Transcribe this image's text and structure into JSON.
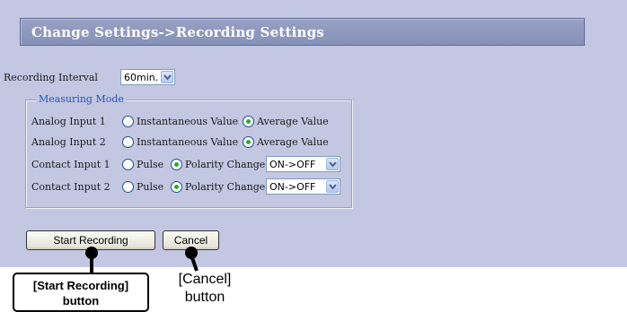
{
  "header": {
    "title": "Change Settings->Recording Settings"
  },
  "recording_interval": {
    "label": "Recording Interval",
    "value": "60min."
  },
  "measuring_mode": {
    "legend": "Measuring Mode",
    "rows": [
      {
        "label": "Analog Input 1",
        "option_a": "Instantaneous Value",
        "option_b": "Average Value",
        "selected": "option_b"
      },
      {
        "label": "Analog Input 2",
        "option_a": "Instantaneous Value",
        "option_b": "Average Value",
        "selected": "option_b"
      },
      {
        "label": "Contact Input 1",
        "option_a": "Pulse",
        "option_b": "Polarity Change",
        "selected": "option_b",
        "select_value": "ON->OFF"
      },
      {
        "label": "Contact Input 2",
        "option_a": "Pulse",
        "option_b": "Polarity Change",
        "selected": "option_b",
        "select_value": "ON->OFF"
      }
    ]
  },
  "buttons": {
    "start_label": "Start Recording",
    "cancel_label": "Cancel"
  },
  "callouts": {
    "start": {
      "line1": "[Start Recording]",
      "line2": "button"
    },
    "cancel": {
      "line1": "[Cancel]",
      "line2": "button"
    }
  }
}
